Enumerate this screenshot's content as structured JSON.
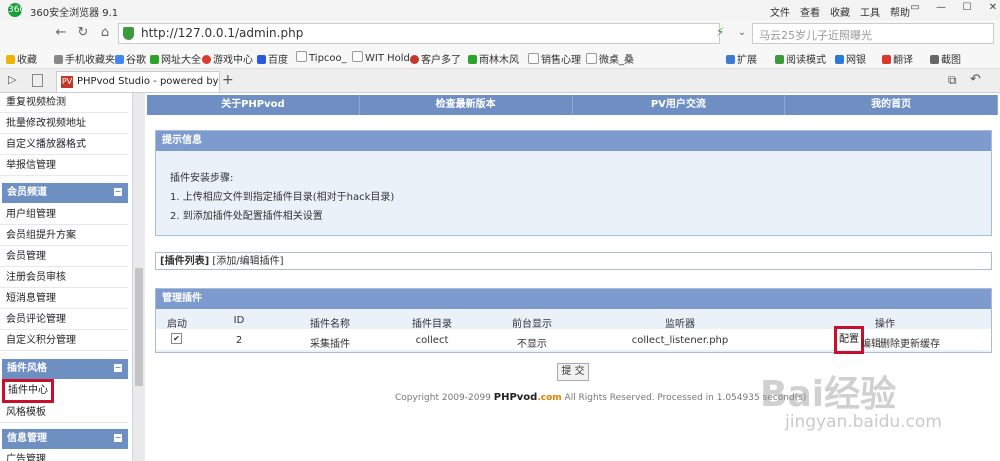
{
  "browser": {
    "app_title": "360安全浏览器 9.1",
    "menus": [
      "文件",
      "查看",
      "收藏",
      "工具",
      "帮助"
    ],
    "url": "http://127.0.0.1/admin.php",
    "search_placeholder": "马云25岁儿子近照曝光",
    "bookmarks": [
      "收藏",
      "手机收藏夹",
      "谷歌",
      "网址大全",
      "游戏中心",
      "百度",
      "Tipcoo_",
      "WIT Hold",
      "客户多了",
      "雨林木风",
      "销售心理",
      "微桌_桑"
    ],
    "toolbar_right": [
      "扩展",
      "阅读模式",
      "网银",
      "翻译",
      "截图"
    ],
    "tab_title": "PHPvod Studio - powered by"
  },
  "sidebar": {
    "items_top": [
      "重复视频检测",
      "批量修改视频地址",
      "自定义播放器格式",
      "举报信管理"
    ],
    "section_member": {
      "title": "会员频道",
      "items": [
        "用户组管理",
        "会员组提升方案",
        "会员管理",
        "注册会员审核",
        "短消息管理",
        "会员评论管理",
        "自定义积分管理"
      ]
    },
    "section_plugin": {
      "title": "插件风格",
      "items": [
        "插件中心",
        "风格模板"
      ]
    },
    "section_info": {
      "title": "信息管理",
      "items": [
        "广告管理"
      ]
    }
  },
  "topnav": [
    "关于PHPvod",
    "检查最新版本",
    "PV用户交流",
    "我的首页"
  ],
  "tips": {
    "title": "提示信息",
    "heading": "插件安装步骤:",
    "steps": [
      "1. 上传相应文件到指定插件目录(相对于hack目录)",
      "2. 到添加插件处配置插件相关设置"
    ]
  },
  "tabs": {
    "list": "[插件列表]",
    "add": "[添加/编辑插件]"
  },
  "plugins": {
    "title": "管理插件",
    "columns": [
      "启动",
      "ID",
      "插件名称",
      "插件目录",
      "前台显示",
      "监听器",
      "操作"
    ],
    "rows": [
      {
        "enabled": "✔",
        "id": "2",
        "name": "采集插件",
        "dir": "collect",
        "front": "不显示",
        "listener": "collect_listener.php"
      }
    ],
    "actions": [
      "配置",
      "编辑",
      "删除",
      "更新缓存"
    ]
  },
  "submit_label": "提 交",
  "footer": {
    "prefix": "Copyright 2009-2099 ",
    "brand": "PHPvod",
    "brand_suffix": ".com",
    "suffix": " All Rights Reserved. Processed in 1.054935 second(s)"
  },
  "watermark": {
    "text": "Bai经验",
    "url": "jingyan.baidu.com"
  }
}
